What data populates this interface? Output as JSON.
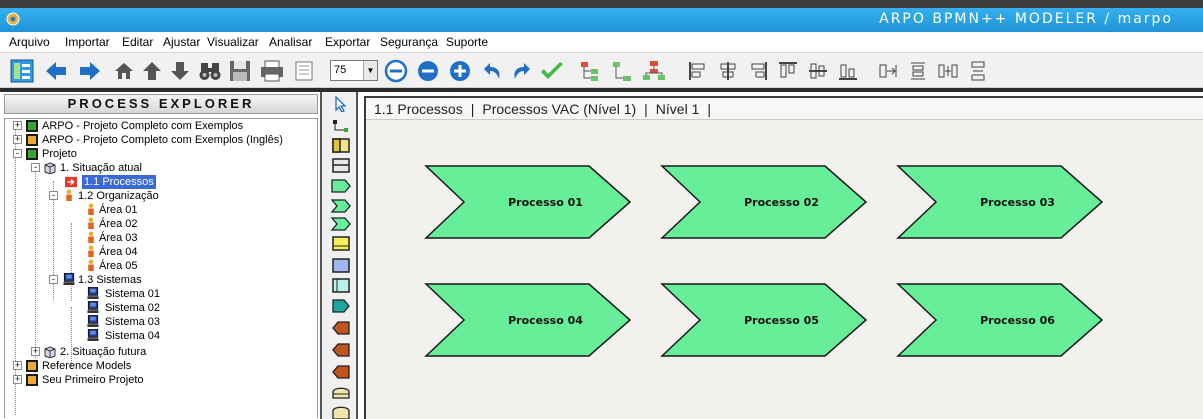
{
  "window": {
    "title": "ARPO BPMN++ MODELER  /  marpo"
  },
  "menu": [
    "Arquivo",
    "Importar",
    "Editar",
    "Ajustar",
    "Visualizar",
    "Analisar",
    "Exportar",
    "Segurança",
    "Suporte"
  ],
  "toolbar": {
    "zoom_value": "75",
    "icons": [
      "explorer-toggle-icon",
      "back-arrow-icon",
      "forward-arrow-icon",
      "home-icon",
      "up-arrow-icon",
      "down-arrow-icon",
      "binoculars-icon",
      "save-icon",
      "print-icon",
      "zoom-out-icon",
      "zoom-fit-icon",
      "zoom-in-icon",
      "undo-icon",
      "redo-icon",
      "validate-check-icon",
      "tree-layout-icon",
      "tree-layout-2-icon",
      "org-layout-icon",
      "align-left-icon",
      "align-center-icon",
      "align-right-icon",
      "align-top-icon",
      "align-middle-icon",
      "align-bottom-icon",
      "same-width-icon",
      "same-height-icon",
      "space-horizontal-icon",
      "space-vertical-icon"
    ]
  },
  "explorer": {
    "title": "PROCESS EXPLORER",
    "items": [
      {
        "label": "ARPO - Projeto Completo com Exemplos",
        "level": 0,
        "expander": "+",
        "icon": "project-green-icon"
      },
      {
        "label": "ARPO - Projeto Completo com Exemplos (Inglês)",
        "level": 0,
        "expander": "+",
        "icon": "project-orange-icon"
      },
      {
        "label": "Projeto",
        "level": 0,
        "expander": "-",
        "icon": "project-green-icon"
      },
      {
        "label": "1. Situação atual",
        "level": 1,
        "expander": "-",
        "icon": "cube-icon"
      },
      {
        "label": "1.1 Processos",
        "level": 2,
        "expander": "",
        "icon": "process-arrow-icon",
        "selected": true
      },
      {
        "label": "1.2 Organização",
        "level": 2,
        "expander": "-",
        "icon": "person-icon"
      },
      {
        "label": "Área 01",
        "level": 3,
        "expander": "",
        "icon": "person-icon"
      },
      {
        "label": "Área 02",
        "level": 3,
        "expander": "",
        "icon": "person-icon"
      },
      {
        "label": "Área 03",
        "level": 3,
        "expander": "",
        "icon": "person-icon"
      },
      {
        "label": "Área 04",
        "level": 3,
        "expander": "",
        "icon": "person-icon"
      },
      {
        "label": "Área 05",
        "level": 3,
        "expander": "",
        "icon": "person-icon"
      },
      {
        "label": "1.3 Sistemas",
        "level": 2,
        "expander": "-",
        "icon": "computer-icon"
      },
      {
        "label": "Sistema 01",
        "level": 3,
        "expander": "",
        "icon": "computer-icon"
      },
      {
        "label": "Sistema 02",
        "level": 3,
        "expander": "",
        "icon": "computer-icon"
      },
      {
        "label": "Sistema 03",
        "level": 3,
        "expander": "",
        "icon": "computer-icon"
      },
      {
        "label": "Sistema 04",
        "level": 3,
        "expander": "",
        "icon": "computer-icon"
      },
      {
        "label": "2. Situação futura",
        "level": 1,
        "expander": "+",
        "icon": "cube-icon"
      },
      {
        "label": "Reference Models",
        "level": 0,
        "expander": "+",
        "icon": "project-orange-icon"
      },
      {
        "label": "Seu Primeiro Projeto",
        "level": 0,
        "expander": "+",
        "icon": "project-orange-icon"
      }
    ]
  },
  "palette": [
    "pointer-tool-icon",
    "connector-tool-icon",
    "shape-box-split-icon",
    "shape-box-striped-icon",
    "shape-chevron-icon",
    "shape-chevron-double-icon",
    "shape-chevron-outline-icon",
    "shape-yellow-box-icon",
    "shape-blue-box-icon",
    "shape-cyan-box-icon",
    "shape-teal-pentagon-icon",
    "shape-brown-left-icon",
    "shape-brown-left-2-icon",
    "shape-brown-left-3-icon",
    "shape-dome-icon",
    "shape-dome-2-icon"
  ],
  "canvas": {
    "breadcrumb": [
      "1.1 Processos",
      "Processos VAC (Nível 1)",
      "Nível 1"
    ],
    "processes": [
      "Processo 01",
      "Processo 02",
      "Processo 03",
      "Processo 04",
      "Processo 05",
      "Processo 06"
    ],
    "process_fill": "#66ee99",
    "process_stroke": "#1a1a1a"
  }
}
